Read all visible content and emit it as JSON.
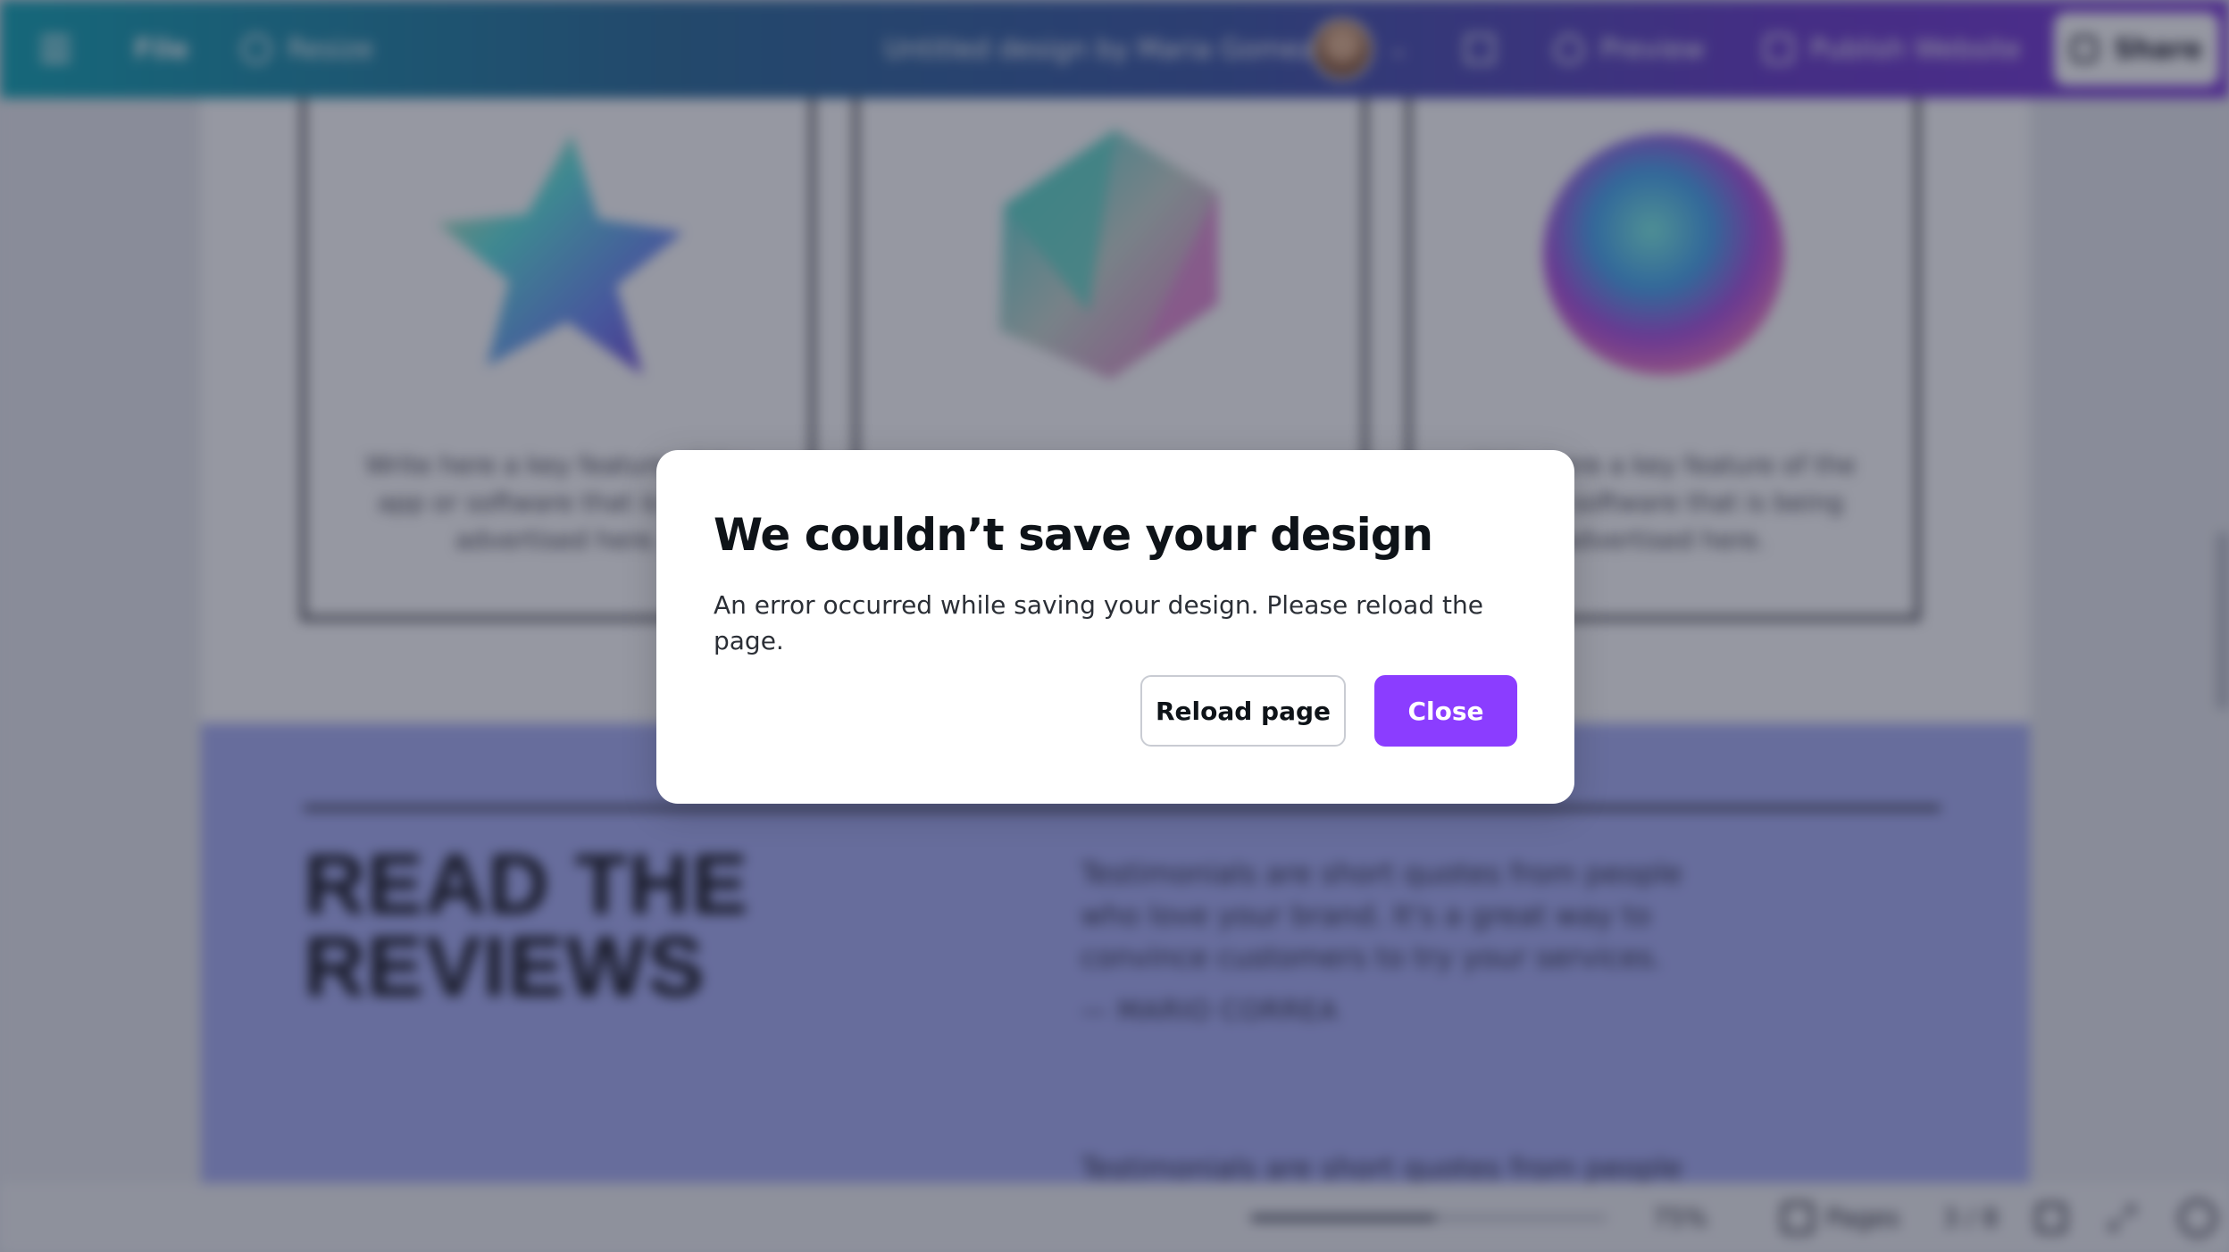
{
  "topbar": {
    "menu_icon": "hamburger-menu-icon",
    "file_label": "File",
    "resize_label": "Resize",
    "doc_title": "Untitled design by Maria Gomez",
    "avatar_chevron": "⌄",
    "preview_label": "Preview",
    "publish_label": "Publish Website",
    "share_label": "Share"
  },
  "design": {
    "features": [
      {
        "shape": "holographic-star",
        "text": "Write here a key feature of the app or software that is being advertised here."
      },
      {
        "shape": "holographic-icosahedron",
        "text": ""
      },
      {
        "shape": "holographic-sphere",
        "text": "Write here a key feature of the app or software that is being advertised here."
      }
    ],
    "reviews": {
      "heading": "READ THE REVIEWS",
      "quote_1": "Testimonials are short quotes from people who love your brand. It's a great way to convince customers to try your services.",
      "author": "— MARIO CORREA",
      "quote_2": "Testimonials are short quotes from people who"
    }
  },
  "bottombar": {
    "zoom_level": "75%",
    "pages_label": "Pages",
    "page_count": "3 / 8"
  },
  "dialog": {
    "title": "We couldn’t save your design",
    "message": "An error occurred while saving your design. Please reload the page.",
    "reload_label": "Reload page",
    "close_label": "Close"
  },
  "colors": {
    "primary_button": "#8b3dff",
    "overlay": "rgba(23,27,49,0.45)",
    "reviews_band": "#aab1f5"
  }
}
